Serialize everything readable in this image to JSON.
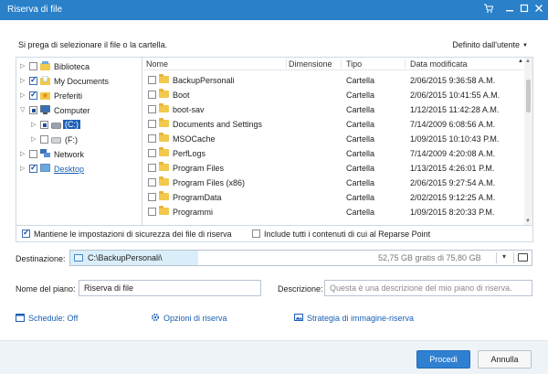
{
  "window": {
    "title": "Riserva di file",
    "controls": [
      "cart-icon",
      "minimize-icon",
      "maximize-icon",
      "close-icon"
    ]
  },
  "prompt": "Si prega di selezionare il file o la cartella.",
  "view_selector": {
    "label": "Definito dall'utente"
  },
  "tree": [
    {
      "label": "Biblioteca",
      "checked": false,
      "icon": "library-icon"
    },
    {
      "label": "My Documents",
      "checked": true,
      "icon": "documents-icon"
    },
    {
      "label": "Preferiti",
      "checked": true,
      "icon": "favorites-icon"
    },
    {
      "label": "Computer",
      "checked": "partial",
      "icon": "computer-icon"
    },
    {
      "label": "(C:)",
      "checked": "partial",
      "icon": "drive-icon",
      "selected": true
    },
    {
      "label": "(F:)",
      "checked": false,
      "icon": "drive-icon"
    },
    {
      "label": "Network",
      "checked": false,
      "icon": "network-icon"
    },
    {
      "label": "Desktop",
      "checked": true,
      "icon": "desktop-icon",
      "link": true
    }
  ],
  "columns": {
    "name": "Nome",
    "size": "Dimensione",
    "type": "Tipo",
    "date": "Data modificata"
  },
  "files": [
    {
      "name": "BackupPersonali",
      "type": "Cartella",
      "date": "2/06/2015 9:36:58 A.M."
    },
    {
      "name": "Boot",
      "type": "Cartella",
      "date": "2/06/2015 10:41:55 A.M."
    },
    {
      "name": "boot-sav",
      "type": "Cartella",
      "date": "1/12/2015 11:42:28 A.M."
    },
    {
      "name": "Documents and Settings",
      "type": "Cartella",
      "date": "7/14/2009 6:08:56 A.M."
    },
    {
      "name": "MSOCache",
      "type": "Cartella",
      "date": "1/09/2015 10:10:43 P.M."
    },
    {
      "name": "PerfLogs",
      "type": "Cartella",
      "date": "7/14/2009 4:20:08 A.M."
    },
    {
      "name": "Program Files",
      "type": "Cartella",
      "date": "1/13/2015 4:26:01 P.M."
    },
    {
      "name": "Program Files (x86)",
      "type": "Cartella",
      "date": "2/06/2015 9:27:54 A.M."
    },
    {
      "name": "ProgramData",
      "type": "Cartella",
      "date": "2/02/2015 9:12:25 A.M."
    },
    {
      "name": "Programmi",
      "type": "Cartella",
      "date": "1/09/2015 8:20:33 P.M."
    }
  ],
  "options": {
    "keep_security": "Mantiene le impostazioni di sicurezza dei file di riserva",
    "keep_security_checked": true,
    "include_reparse": "Include tutti i contenuti di cui al Reparse Point",
    "include_reparse_checked": false
  },
  "destination": {
    "label": "Destinazione:",
    "path": "C:\\BackupPersonali\\",
    "free_space": "52,75 GB gratis di 75,80 GB"
  },
  "plan": {
    "label": "Nome del piano:",
    "value": "Riserva di file"
  },
  "description": {
    "label": "Descrizione:",
    "placeholder": "Questa è una descrizione del mio piano di riserva."
  },
  "links": {
    "schedule": "Schedule: Off",
    "backup_options": "Opzioni di riserva",
    "image_strategy": "Strategia di immagine-riserva"
  },
  "buttons": {
    "proceed": "Procedi",
    "cancel": "Annulla"
  },
  "colors": {
    "titlebar": "#2a80c9",
    "accent": "#2f80d1",
    "link": "#1a5fb4",
    "selection": "#1e5fb8"
  }
}
